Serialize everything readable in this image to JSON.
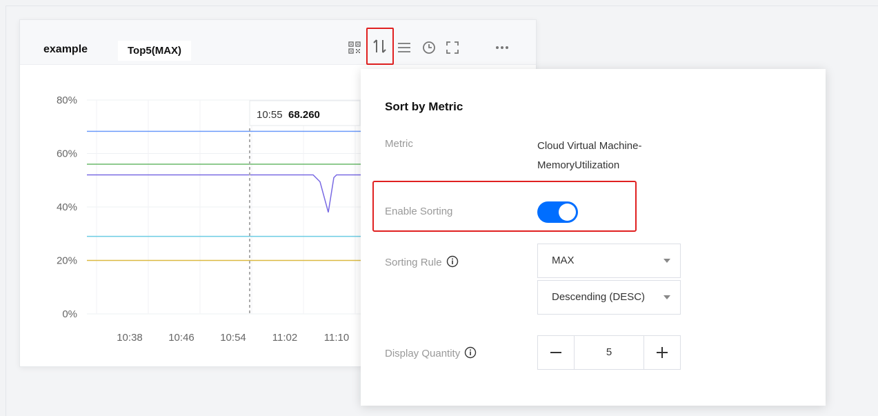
{
  "panel": {
    "title": "example",
    "tag": "Top5(MAX)",
    "toolbar": [
      "qr-code-icon",
      "sort-icon",
      "list-icon",
      "clock-icon",
      "fullscreen-icon",
      "more-icon"
    ]
  },
  "tooltip": {
    "time": "10:55",
    "value": "68.260"
  },
  "chart_data": {
    "type": "line",
    "x": [
      "10:38",
      "10:46",
      "10:54",
      "11:02",
      "11:10"
    ],
    "yticks": [
      "80%",
      "60%",
      "40%",
      "20%",
      "0%"
    ],
    "ylim": [
      0,
      80
    ],
    "grid": true,
    "series": [
      {
        "color": "#5b8ff9",
        "values": [
          68.3,
          68.3,
          68.3,
          68.3,
          68.3
        ]
      },
      {
        "color": "#5ab15a",
        "values": [
          56,
          55.8,
          56,
          56,
          56
        ]
      },
      {
        "color": "#6a5ae0",
        "values": [
          52,
          52,
          52,
          52,
          52
        ]
      },
      {
        "color": "#5bc6e0",
        "values": [
          29,
          29,
          29,
          29,
          29
        ]
      },
      {
        "color": "#d8b22d",
        "values": [
          20,
          20,
          20,
          20,
          20
        ]
      }
    ],
    "dip": {
      "series": 2,
      "value": 38
    }
  },
  "popover": {
    "title": "Sort by Metric",
    "metric_label": "Metric",
    "metric_value_line1": "Cloud Virtual Machine-",
    "metric_value_line2": "MemoryUtilization",
    "enable_sorting_label": "Enable Sorting",
    "enable_sorting_on": true,
    "sorting_rule_label": "Sorting Rule",
    "sorting_rule_value": "MAX",
    "sorting_order_value": "Descending (DESC)",
    "display_quantity_label": "Display Quantity",
    "display_quantity_value": "5",
    "accent": "#006eff"
  }
}
